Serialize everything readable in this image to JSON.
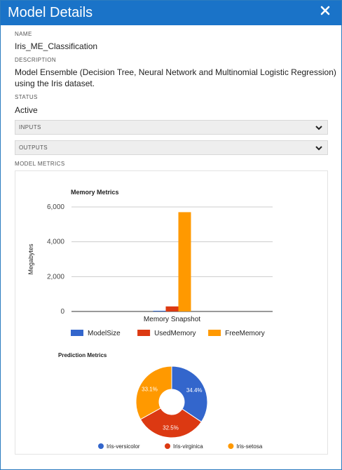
{
  "dialog": {
    "title": "Model Details"
  },
  "fields": {
    "name_label": "NAME",
    "name_value": "Iris_ME_Classification",
    "description_label": "DESCRIPTION",
    "description_line1": "Model Ensemble (Decision Tree, Neural Network and Multinomial Logistic Regression)",
    "description_line2": "using the Iris dataset.",
    "status_label": "STATUS",
    "status_value": "Active"
  },
  "sections": {
    "inputs_label": "INPUTS",
    "outputs_label": "OUTPUTS",
    "model_metrics_label": "MODEL METRICS"
  },
  "icons": {
    "close": "close-icon",
    "chevron": "chevron-down-icon"
  },
  "chart_data": [
    {
      "type": "bar",
      "title": "Memory Metrics",
      "categories": [
        "Memory Snapshot"
      ],
      "ylabel": "Megabytes",
      "xlabel": "",
      "ylim": [
        0,
        6000
      ],
      "yticks": [
        0,
        2000,
        4000,
        6000
      ],
      "ytick_labels": [
        "0",
        "2,000",
        "4,000",
        "6,000"
      ],
      "grid": true,
      "legend_position": "bottom",
      "series": [
        {
          "name": "ModelSize",
          "values": [
            2
          ],
          "color": "#3366cc"
        },
        {
          "name": "UsedMemory",
          "values": [
            290
          ],
          "color": "#dc3912"
        },
        {
          "name": "FreeMemory",
          "values": [
            5700
          ],
          "color": "#ff9900"
        }
      ]
    },
    {
      "type": "pie",
      "title": "Prediction Metrics",
      "donut": true,
      "legend_position": "bottom",
      "slices": [
        {
          "name": "Iris-versicolor",
          "value": 34.4,
          "label": "34.4%",
          "color": "#3366cc"
        },
        {
          "name": "Iris-virginica",
          "value": 32.5,
          "label": "32.5%",
          "color": "#dc3912"
        },
        {
          "name": "Iris-setosa",
          "value": 33.1,
          "label": "33.1%",
          "color": "#ff9900"
        }
      ]
    }
  ]
}
